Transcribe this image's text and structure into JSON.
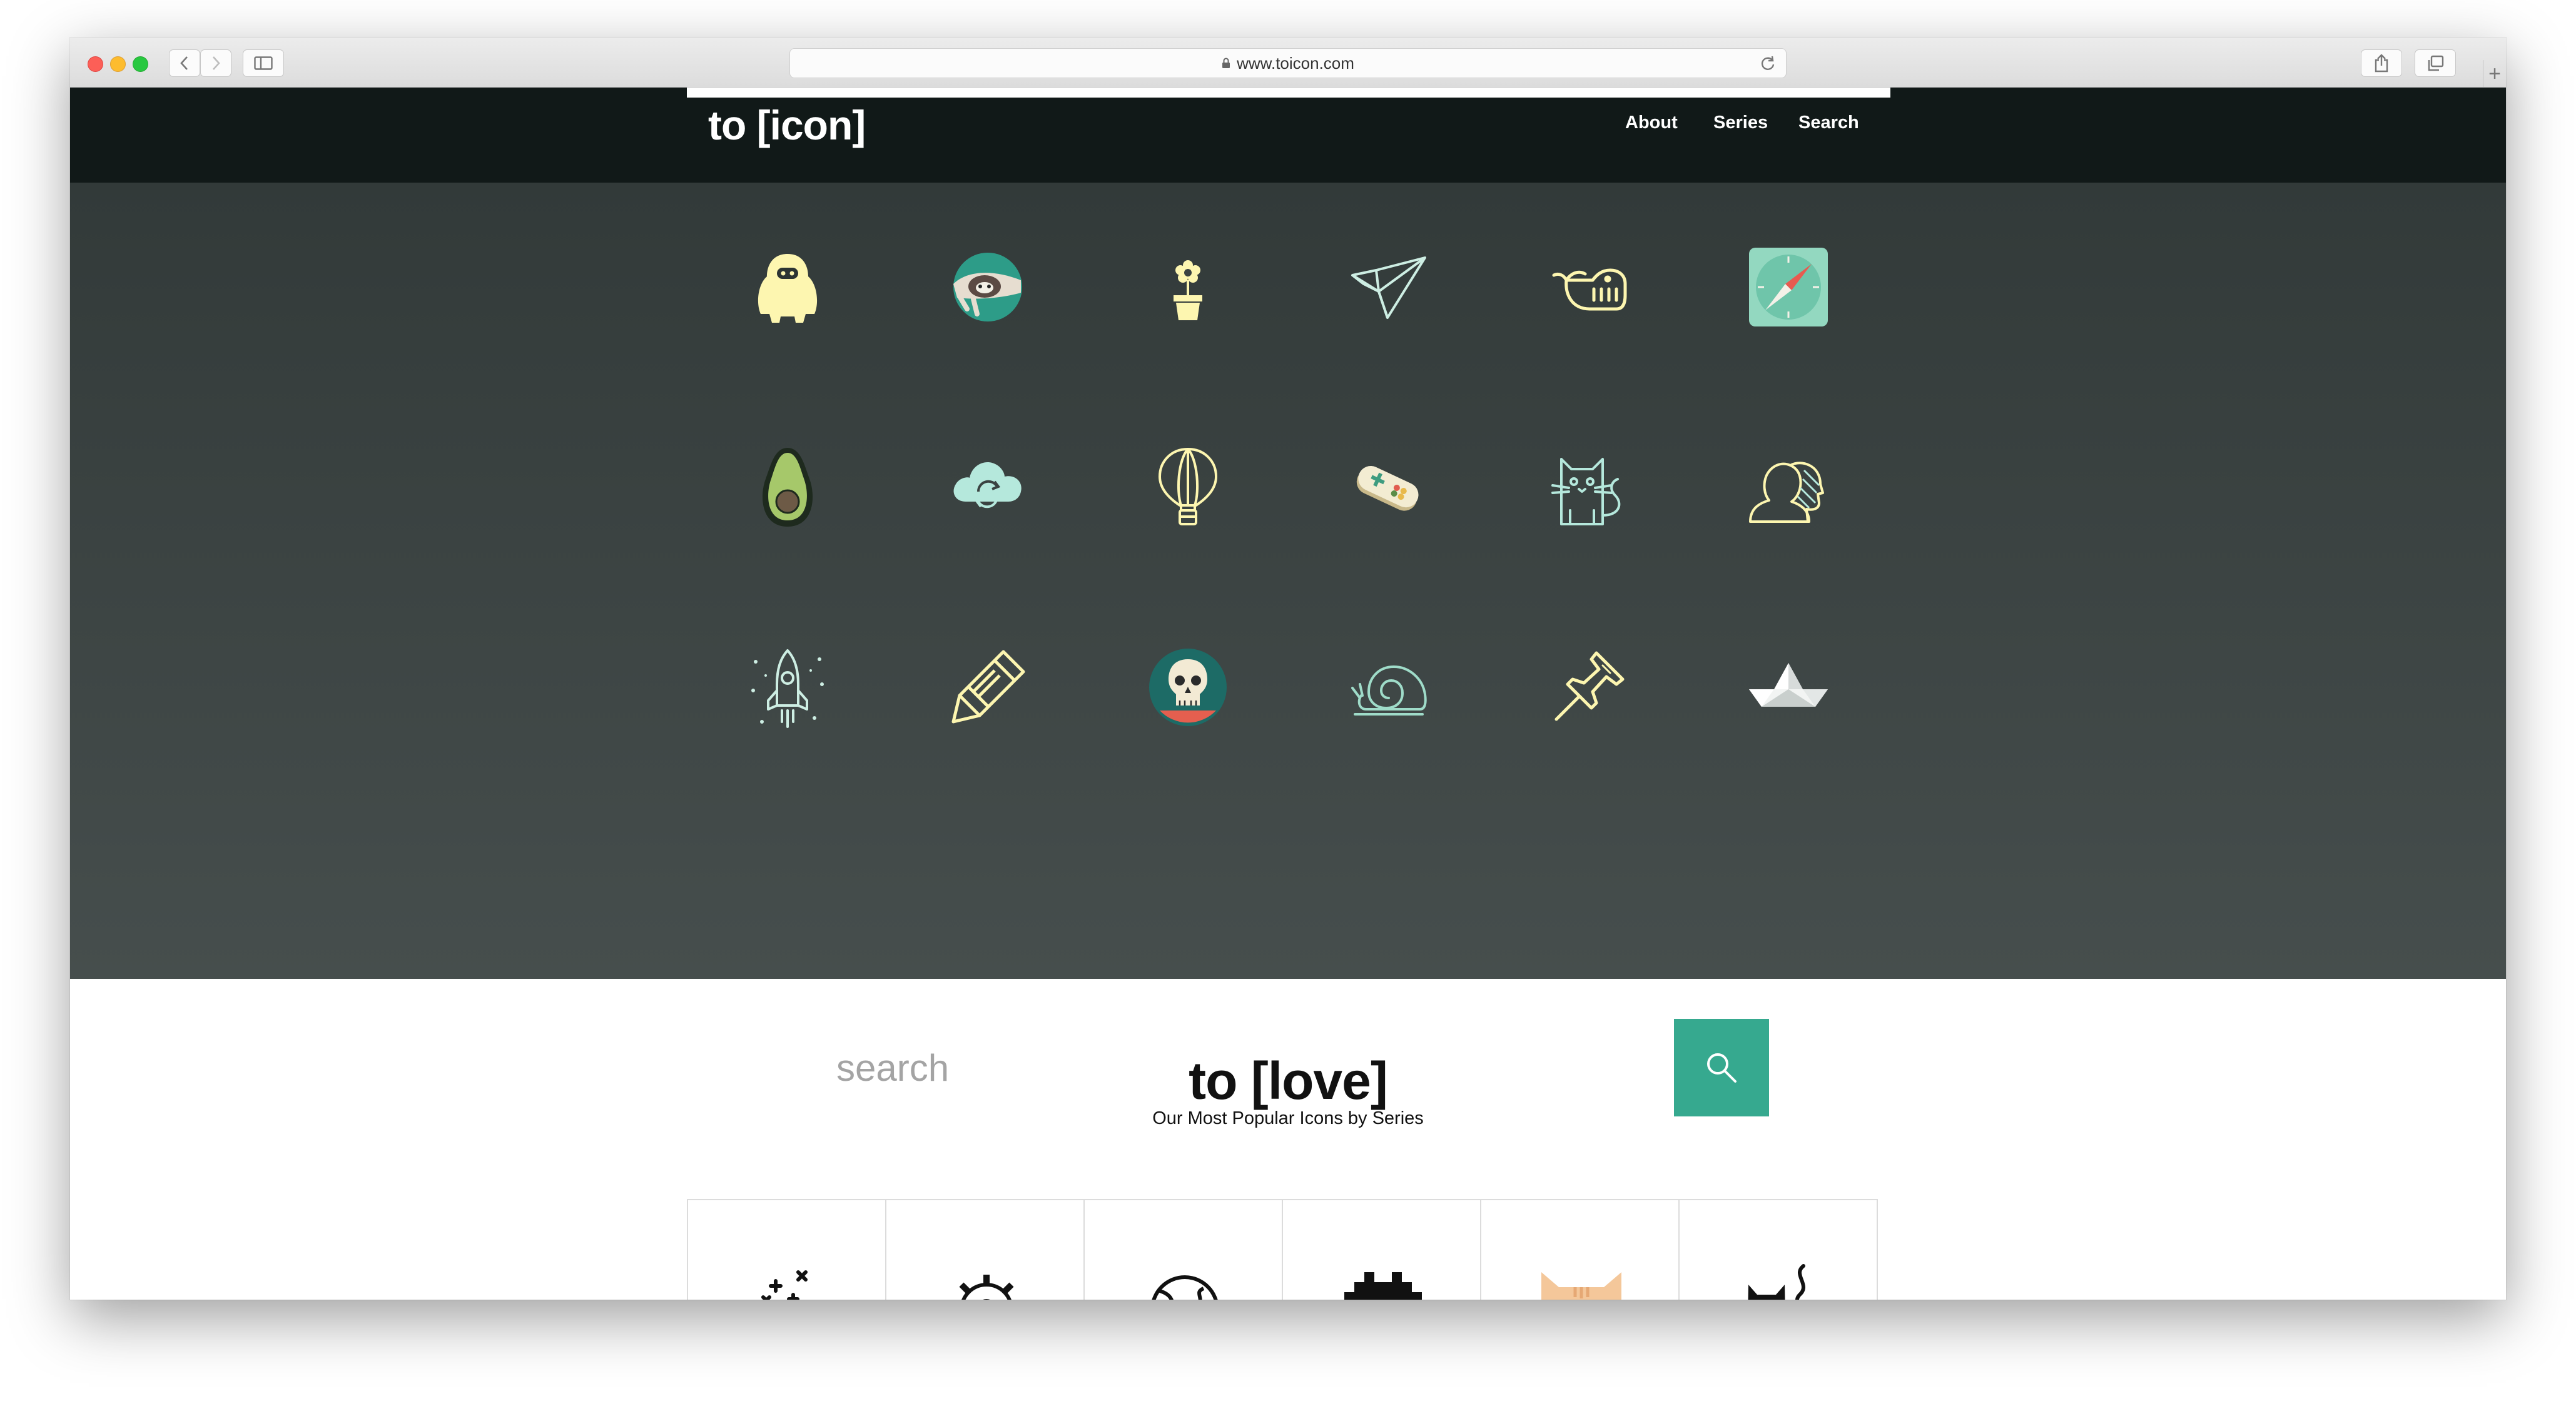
{
  "browser": {
    "url": "www.toicon.com",
    "icons": [
      "back-icon",
      "forward-icon",
      "sidebar-icon",
      "lock-icon",
      "reload-icon",
      "share-icon",
      "tabs-icon",
      "plus-icon"
    ]
  },
  "header": {
    "logo": "to [icon]",
    "nav": [
      "About",
      "Series",
      "Search"
    ]
  },
  "hero": {
    "icons": [
      "yeti-icon",
      "sloth-icon",
      "flower-pot-icon",
      "origami-bird-icon",
      "whale-icon",
      "compass-icon",
      "avocado-icon",
      "cloud-sync-icon",
      "hot-air-balloon-icon",
      "gamepad-icon",
      "cat-icon",
      "profile-silhouette-icon",
      "rocket-icon",
      "crayon-icon",
      "skull-icon",
      "snail-icon",
      "push-pin-icon",
      "paper-boat-icon"
    ],
    "search": {
      "placeholder": "search",
      "value": ""
    }
  },
  "popular": {
    "title": "to [love]",
    "subtitle": "Our Most Popular Icons by Series",
    "series_icons": [
      "magic-wand-icon",
      "gear-icon",
      "globe-icon",
      "pixel-invader-icon",
      "cat-face-icon",
      "black-cat-icon"
    ]
  },
  "colors": {
    "header_bg": "#111918",
    "hero_top": "#323a39",
    "hero_bottom": "#464e4d",
    "accent": "#36a98f",
    "icon_yellow": "#fdf6b0",
    "icon_mint": "#9fdcc9"
  }
}
